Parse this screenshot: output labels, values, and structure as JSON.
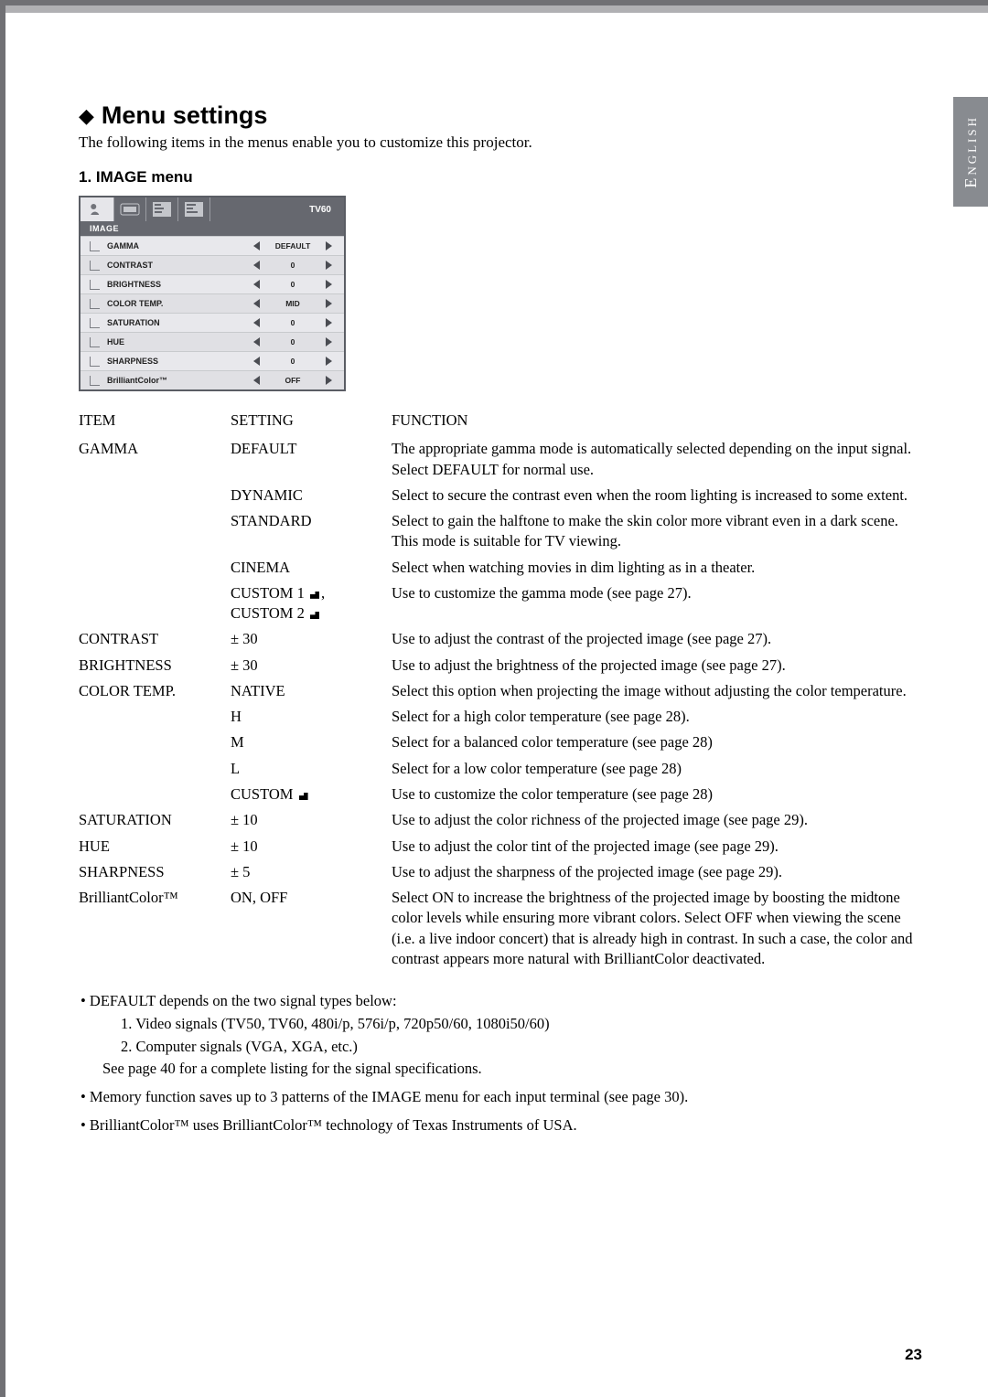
{
  "language_tab": "English",
  "heading": "Menu settings",
  "intro": "The following items in the menus enable you to customize this projector.",
  "subheading": "1. IMAGE menu",
  "osd_signal": "TV60",
  "osd_section": "IMAGE",
  "osd_rows": [
    {
      "label": "GAMMA",
      "value": "DEFAULT"
    },
    {
      "label": "CONTRAST",
      "value": "0"
    },
    {
      "label": "BRIGHTNESS",
      "value": "0"
    },
    {
      "label": "COLOR TEMP.",
      "value": "MID"
    },
    {
      "label": "SATURATION",
      "value": "0"
    },
    {
      "label": "HUE",
      "value": "0"
    },
    {
      "label": "SHARPNESS",
      "value": "0"
    },
    {
      "label": "BrilliantColor™",
      "value": "OFF"
    }
  ],
  "table_headers": {
    "item": "ITEM",
    "setting": "SETTING",
    "function": "FUNCTION"
  },
  "rows": [
    {
      "item": "GAMMA",
      "setting": "DEFAULT",
      "func": "The appropriate gamma mode is automatically selected depending on the input signal. Select DEFAULT for normal use."
    },
    {
      "item": "",
      "setting": "DYNAMIC",
      "func": "Select to secure the contrast even when the room lighting is increased to some extent."
    },
    {
      "item": "",
      "setting": "STANDARD",
      "func": "Select to gain the halftone to make the skin color more vibrant even in a dark scene. This mode is suitable for TV viewing."
    },
    {
      "item": "",
      "setting": "CINEMA",
      "func": "Select when watching movies in dim lighting as in a theater."
    },
    {
      "item": "",
      "setting_custom12": true,
      "c1": "CUSTOM 1",
      "c2": "CUSTOM 2",
      "func": "Use to customize the gamma mode (see page 27)."
    },
    {
      "item": "CONTRAST",
      "setting": "± 30",
      "func": "Use to adjust the contrast of the projected image (see page 27)."
    },
    {
      "item": "BRIGHTNESS",
      "setting": "± 30",
      "func": "Use to adjust the brightness of the projected image (see page 27)."
    },
    {
      "item": "COLOR TEMP.",
      "setting": "NATIVE",
      "func": "Select this option when projecting the image without adjusting the color temperature."
    },
    {
      "item": "",
      "setting": "H",
      "func": "Select for a high color temperature (see page 28)."
    },
    {
      "item": "",
      "setting": "M",
      "func": "Select for a balanced color temperature (see page 28)"
    },
    {
      "item": "",
      "setting": "L",
      "func": "Select for a low color temperature (see page 28)"
    },
    {
      "item": "",
      "setting_custom": true,
      "c": "CUSTOM",
      "func": "Use to customize the color temperature (see page 28)"
    },
    {
      "item": "SATURATION",
      "setting": "± 10",
      "func": "Use to adjust the color richness of the projected image (see page 29)."
    },
    {
      "item": "HUE",
      "setting": "± 10",
      "func": "Use to adjust the color tint of the projected image (see page 29)."
    },
    {
      "item": "SHARPNESS",
      "setting": "± 5",
      "func": "Use to adjust the sharpness of the projected image (see page 29)."
    },
    {
      "item": "BrilliantColor™",
      "setting": "ON, OFF",
      "func": "Select ON to increase the brightness of the projected image by boosting the midtone color levels while ensuring more vibrant colors. Select OFF when viewing the scene (i.e. a live indoor concert) that is already high in contrast. In such a case, the color and contrast appears more natural with BrilliantColor deactivated."
    }
  ],
  "bullets": {
    "b1": "• DEFAULT depends on the two signal types below:",
    "b2a": "1.  Video signals (TV50, TV60, 480i/p, 576i/p, 720p50/60, 1080i50/60)",
    "b2b": "2.  Computer signals (VGA, XGA, etc.)",
    "b2c": "See page 40 for a complete listing for the signal specifications.",
    "b3": "• Memory function saves up to 3 patterns of the IMAGE menu for each input terminal (see page 30).",
    "b4": "• BrilliantColor™  uses BrilliantColor™  technology of Texas Instruments of USA."
  },
  "page_number": "23"
}
